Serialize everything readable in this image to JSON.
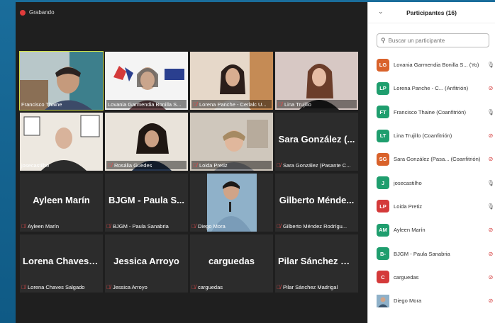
{
  "recording": {
    "label": "Grabando"
  },
  "tiles": [
    {
      "caption": "Francisco Thaine",
      "big": "",
      "muted": false,
      "active": true
    },
    {
      "caption": "Lovania Garmendia Bonilla S...",
      "big": "",
      "muted": false,
      "active": false
    },
    {
      "caption": "Lorena Panche - Cerlalc U...",
      "big": "",
      "muted": true,
      "active": false
    },
    {
      "caption": "Lina Trujillo",
      "big": "",
      "muted": true,
      "active": false
    },
    {
      "caption": "josecastilho",
      "big": "",
      "muted": false,
      "active": false
    },
    {
      "caption": "Rosália Guedes",
      "big": "",
      "muted": true,
      "active": false
    },
    {
      "caption": "Loida Pretiz",
      "big": "",
      "muted": true,
      "active": false
    },
    {
      "caption": "Sara González (Pasante C...",
      "big": "Sara González (...",
      "muted": true,
      "active": false
    },
    {
      "caption": "Ayleen Marín",
      "big": "Ayleen Marín",
      "muted": true,
      "active": false
    },
    {
      "caption": "BJGM - Paula Sanabria",
      "big": "BJGM - Paula S...",
      "muted": true,
      "active": false
    },
    {
      "caption": "Diego Mora",
      "big": "",
      "muted": true,
      "active": false
    },
    {
      "caption": "Gilberto Méndez Rodrígu...",
      "big": "Gilberto Ménde...",
      "muted": true,
      "active": false
    },
    {
      "caption": "Lorena Chaves Salgado",
      "big": "Lorena Chaves S...",
      "muted": true,
      "active": false
    },
    {
      "caption": "Jessica Arroyo",
      "big": "Jessica Arroyo",
      "muted": true,
      "active": false
    },
    {
      "caption": "carguedas",
      "big": "carguedas",
      "muted": true,
      "active": false
    },
    {
      "caption": "Pilar Sánchez Madrigal",
      "big": "Pilar Sánchez M...",
      "muted": true,
      "active": false
    }
  ],
  "panel": {
    "title": "Participantes (16)",
    "search_placeholder": "Buscar un participante",
    "participants": [
      {
        "initials": "LG",
        "color": "#d9622b",
        "name": "Lovania Garmendia Bonilla S... (Yo)",
        "icon": "mic-on"
      },
      {
        "initials": "LP",
        "color": "#1f9e6e",
        "name": "Lorena Panche - C... (Anfitrión)",
        "icon": "mic-off"
      },
      {
        "initials": "FT",
        "color": "#1f9e6e",
        "name": "Francisco Thaine (Coanfitrión)",
        "icon": "mic-on"
      },
      {
        "initials": "LT",
        "color": "#1f9e6e",
        "name": "Lina Trujillo (Coanfitrión)",
        "icon": "mic-off"
      },
      {
        "initials": "SG",
        "color": "#d9622b",
        "name": "Sara González (Pasa... (Coanfitrión)",
        "icon": "mic-off"
      },
      {
        "initials": "J",
        "color": "#1f9e6e",
        "name": "josecastilho",
        "icon": "mic-on"
      },
      {
        "initials": "LP",
        "color": "#d43a3a",
        "name": "Loida Pretiz",
        "icon": "mic-on"
      },
      {
        "initials": "AM",
        "color": "#1f9e6e",
        "name": "Ayleen Marín",
        "icon": "mic-off"
      },
      {
        "initials": "B-",
        "color": "#1f9e6e",
        "name": "BJGM - Paula Sanabria",
        "icon": "mic-off"
      },
      {
        "initials": "C",
        "color": "#d43a3a",
        "name": "carguedas",
        "icon": "mic-off"
      },
      {
        "initials": "",
        "color": "#6a8fb0",
        "name": "Diego Mora",
        "icon": "mic-off"
      }
    ]
  }
}
